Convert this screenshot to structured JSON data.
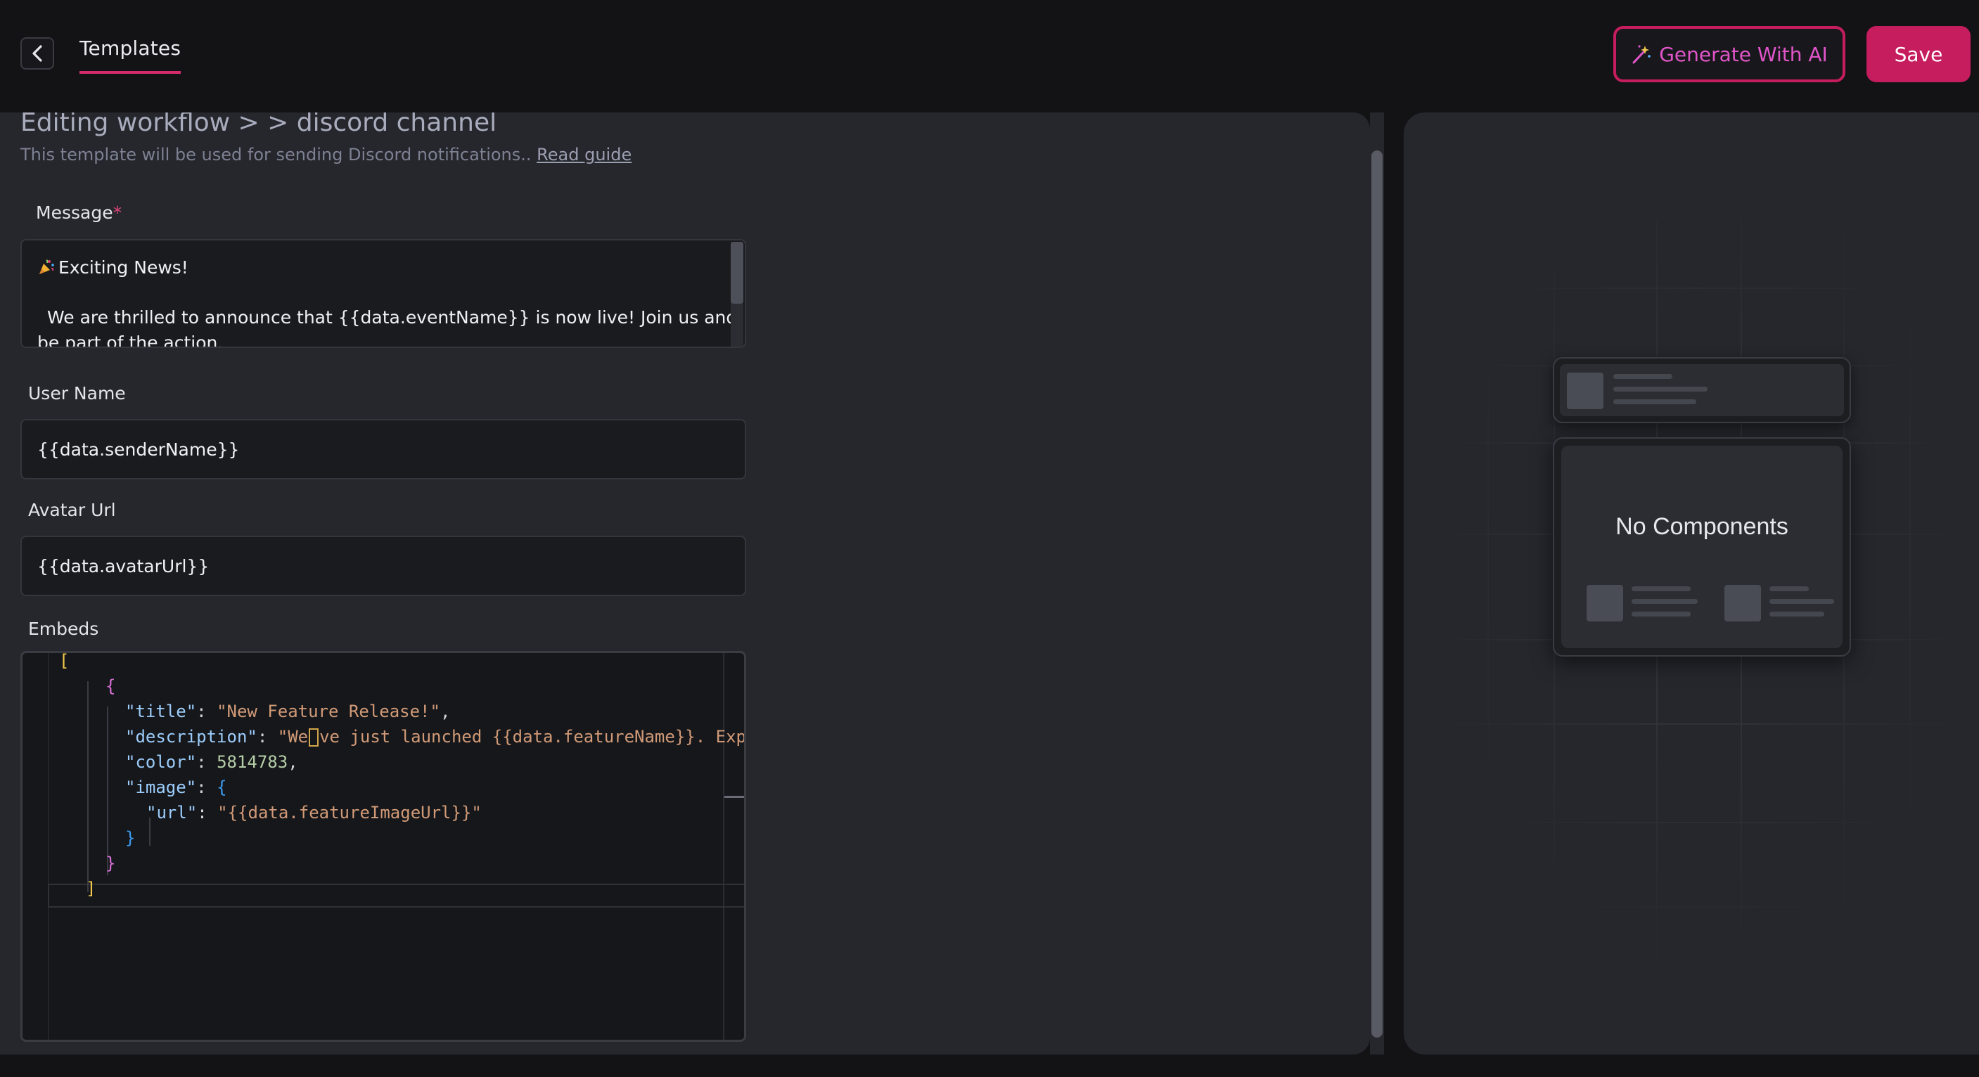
{
  "header": {
    "tab_label": "Templates",
    "generate_label": "Generate With AI",
    "save_label": "Save"
  },
  "editor": {
    "breadcrumb": "Editing workflow > > discord channel",
    "subtitle": "This template will be used for sending Discord notifications..",
    "guide_link": "Read guide",
    "message": {
      "label": "Message",
      "required_mark": "*",
      "line1": "Exciting News!",
      "line2": "We are thrilled to announce that {{data.eventName}} is now live! Join us and be part of the action."
    },
    "username": {
      "label": "User Name",
      "value": "{{data.senderName}}"
    },
    "avatar": {
      "label": "Avatar Url",
      "value": "{{data.avatarUrl}}"
    },
    "embeds": {
      "label": "Embeds",
      "open_bracket": "[",
      "open_brace": "{",
      "title_key": "\"title\"",
      "title_val": "\"New Feature Release!\"",
      "desc_key": "\"description\"",
      "desc_val_a": "\"We",
      "desc_val_b": "ve just launched {{data.featureName}}. Exp",
      "color_key": "\"color\"",
      "color_val": "5814783",
      "image_key": "\"image\"",
      "image_open": "{",
      "url_key": "\"url\"",
      "url_val": "\"{{data.featureImageUrl}}\"",
      "image_close": "}",
      "close_brace": "}",
      "close_bracket": "]"
    }
  },
  "preview": {
    "empty_text": "No Components"
  },
  "colors": {
    "accent": "#c51d5e",
    "ai_text": "#e055c8",
    "background": "#131316",
    "panel": "#25272d"
  },
  "icons": {
    "back": "chevron-left-icon",
    "ai": "magic-wand-icon",
    "message_emoji": "party-popper-icon"
  }
}
